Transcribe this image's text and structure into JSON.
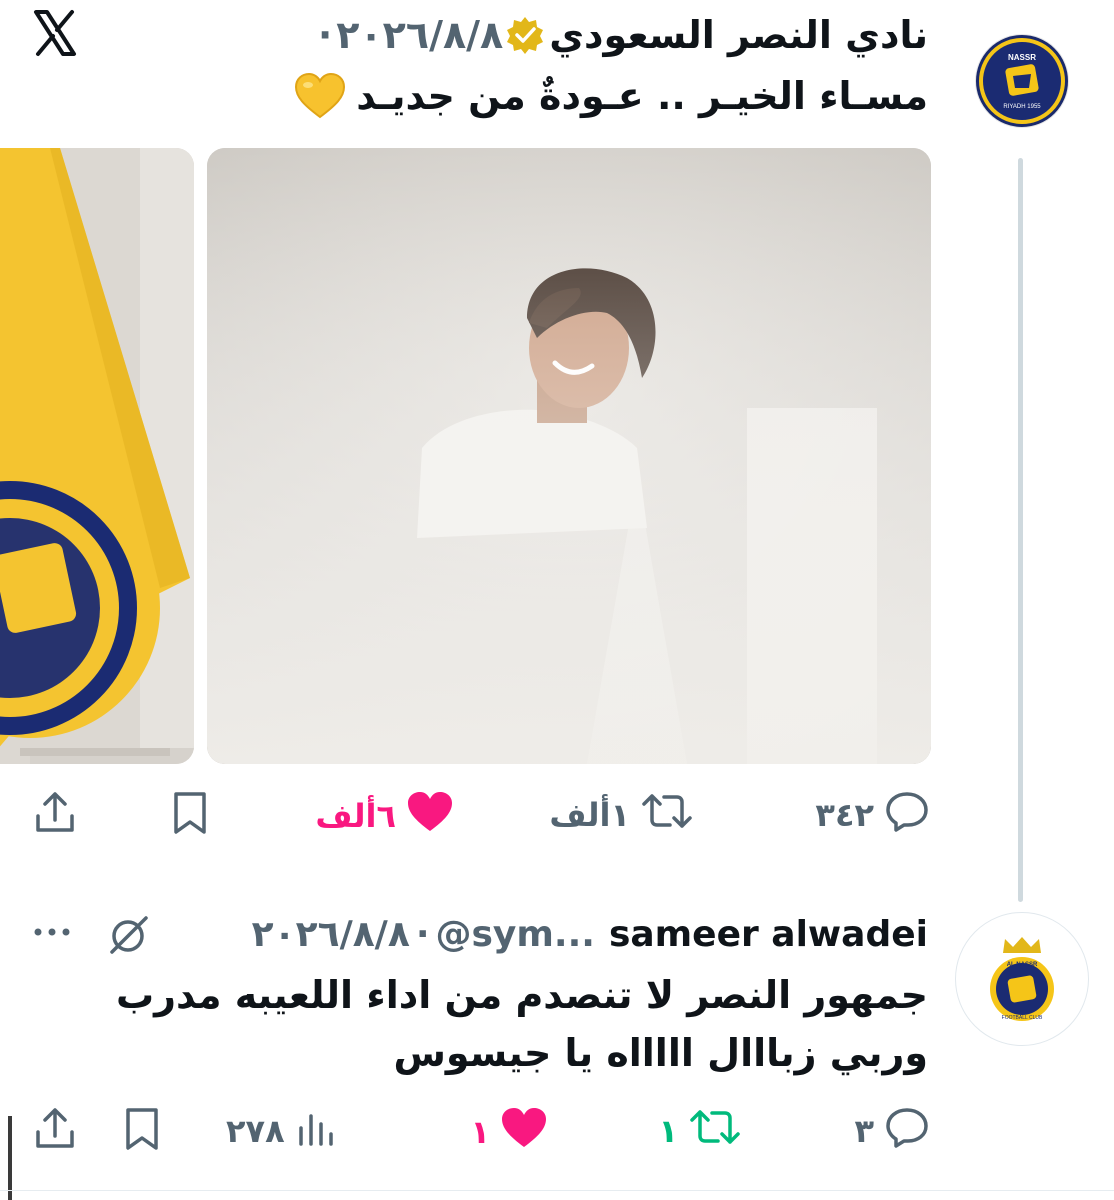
{
  "tweet1": {
    "author": "نادي النصر السعودي",
    "separator": "·",
    "date": "٢٠٢٦/٨/٨",
    "text": "مسـاء الخيـر .. عـودةٌ من جديـد",
    "emoji": "yellow-heart",
    "actions": {
      "replies": "٣٤٢",
      "reposts": "١ألف",
      "likes": "٦ألف"
    }
  },
  "tweet2": {
    "author": "sameer alwadei",
    "handle": "@sym...",
    "separator": "·",
    "date": "٢٠٢٦/٨/٨",
    "text_line1": "جمهور النصر لا تنصدم من اداء اللعيبه مدرب",
    "text_line2": "وربي زبااال اااااه يا جيسوس",
    "actions": {
      "replies": "٣",
      "reposts": "١",
      "likes": "١",
      "views": "٢٧٨"
    }
  },
  "colors": {
    "text": "#0f1419",
    "muted": "#536471",
    "like_active": "#f91880",
    "repost_active": "#00ba7c",
    "verified": "#e2b719",
    "club_yellow": "#f5c518",
    "club_blue": "#1b2b72"
  },
  "icons": [
    "x-logo",
    "verified-badge-icon",
    "reply-icon",
    "repost-icon",
    "like-icon",
    "bookmark-icon",
    "share-icon",
    "views-icon",
    "grok-icon",
    "more-icon"
  ]
}
